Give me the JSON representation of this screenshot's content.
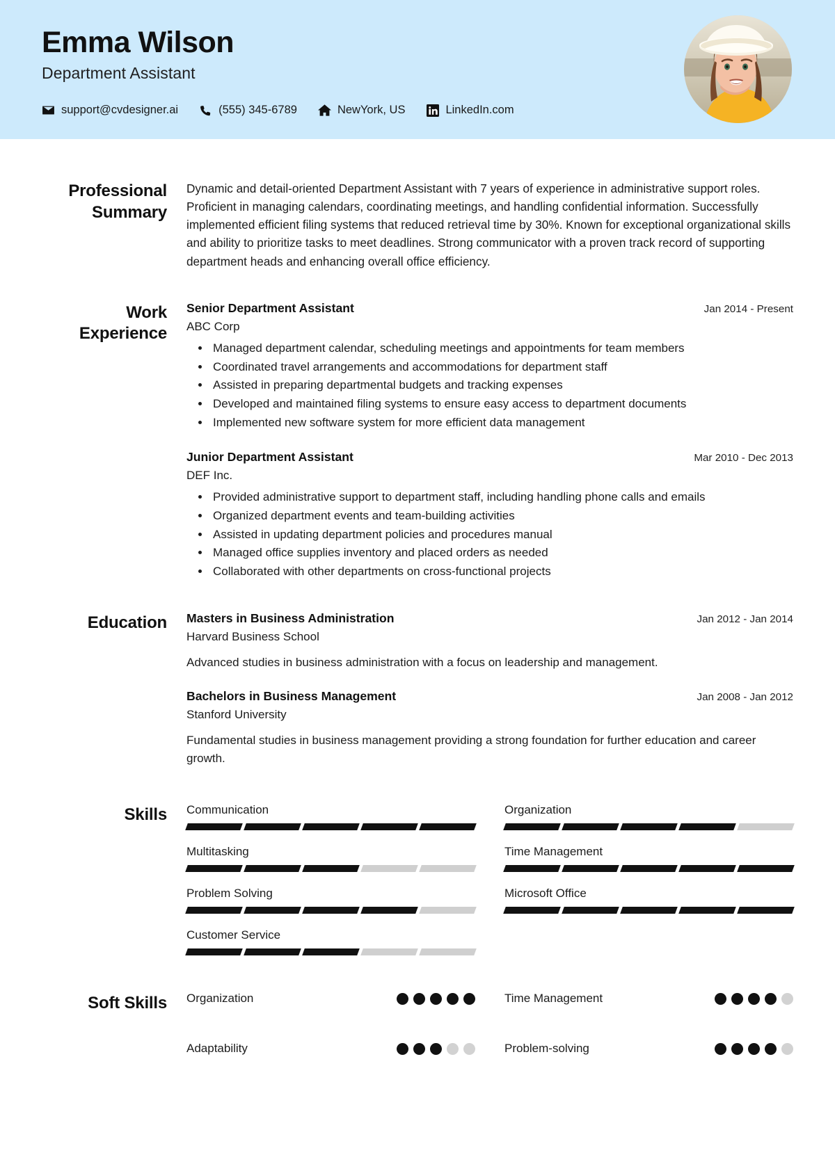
{
  "header": {
    "name": "Emma Wilson",
    "job_title": "Department Assistant",
    "accent_bg": "#cdeafc",
    "contacts": [
      {
        "icon": "envelope-icon",
        "label": "support@cvdesigner.ai"
      },
      {
        "icon": "phone-icon",
        "label": "(555) 345-6789"
      },
      {
        "icon": "home-icon",
        "label": "NewYork, US"
      },
      {
        "icon": "linkedin-icon",
        "label": "LinkedIn.com"
      }
    ]
  },
  "summary": {
    "heading": "Professional Summary",
    "text": "Dynamic and detail-oriented Department Assistant with 7 years of experience in administrative support roles. Proficient in managing calendars, coordinating meetings, and handling confidential information. Successfully implemented efficient filing systems that reduced retrieval time by 30%. Known for exceptional organizational skills and ability to prioritize tasks to meet deadlines. Strong communicator with a proven track record of supporting department heads and enhancing overall office efficiency."
  },
  "experience": {
    "heading": "Work Experience",
    "entries": [
      {
        "title": "Senior Department Assistant",
        "org": "ABC Corp",
        "date": "Jan 2014 - Present",
        "bullets": [
          "Managed department calendar, scheduling meetings and appointments for team members",
          "Coordinated travel arrangements and accommodations for department staff",
          "Assisted in preparing departmental budgets and tracking expenses",
          "Developed and maintained filing systems to ensure easy access to department documents",
          "Implemented new software system for more efficient data management"
        ]
      },
      {
        "title": "Junior Department Assistant",
        "org": "DEF Inc.",
        "date": "Mar 2010 - Dec 2013",
        "bullets": [
          "Provided administrative support to department staff, including handling phone calls and emails",
          "Organized department events and team-building activities",
          "Assisted in updating department policies and procedures manual",
          "Managed office supplies inventory and placed orders as needed",
          "Collaborated with other departments on cross-functional projects"
        ]
      }
    ]
  },
  "education": {
    "heading": "Education",
    "entries": [
      {
        "title": "Masters in Business Administration",
        "org": "Harvard Business School",
        "date": "Jan 2012 - Jan 2014",
        "desc": "Advanced studies in business administration with a focus on leadership and management."
      },
      {
        "title": "Bachelors in Business Management",
        "org": "Stanford University",
        "date": "Jan 2008 - Jan 2012",
        "desc": "Fundamental studies in business management providing a strong foundation for further education and career growth."
      }
    ]
  },
  "skills": {
    "heading": "Skills",
    "max": 5,
    "items": [
      {
        "name": "Communication",
        "level": 5
      },
      {
        "name": "Organization",
        "level": 4
      },
      {
        "name": "Multitasking",
        "level": 3
      },
      {
        "name": "Time Management",
        "level": 5
      },
      {
        "name": "Problem Solving",
        "level": 4
      },
      {
        "name": "Microsoft Office",
        "level": 5
      },
      {
        "name": "Customer Service",
        "level": 3
      }
    ]
  },
  "soft_skills": {
    "heading": "Soft Skills",
    "max": 5,
    "items": [
      {
        "name": "Organization",
        "level": 5
      },
      {
        "name": "Time Management",
        "level": 4
      },
      {
        "name": "Adaptability",
        "level": 3
      },
      {
        "name": "Problem-solving",
        "level": 4
      }
    ]
  }
}
